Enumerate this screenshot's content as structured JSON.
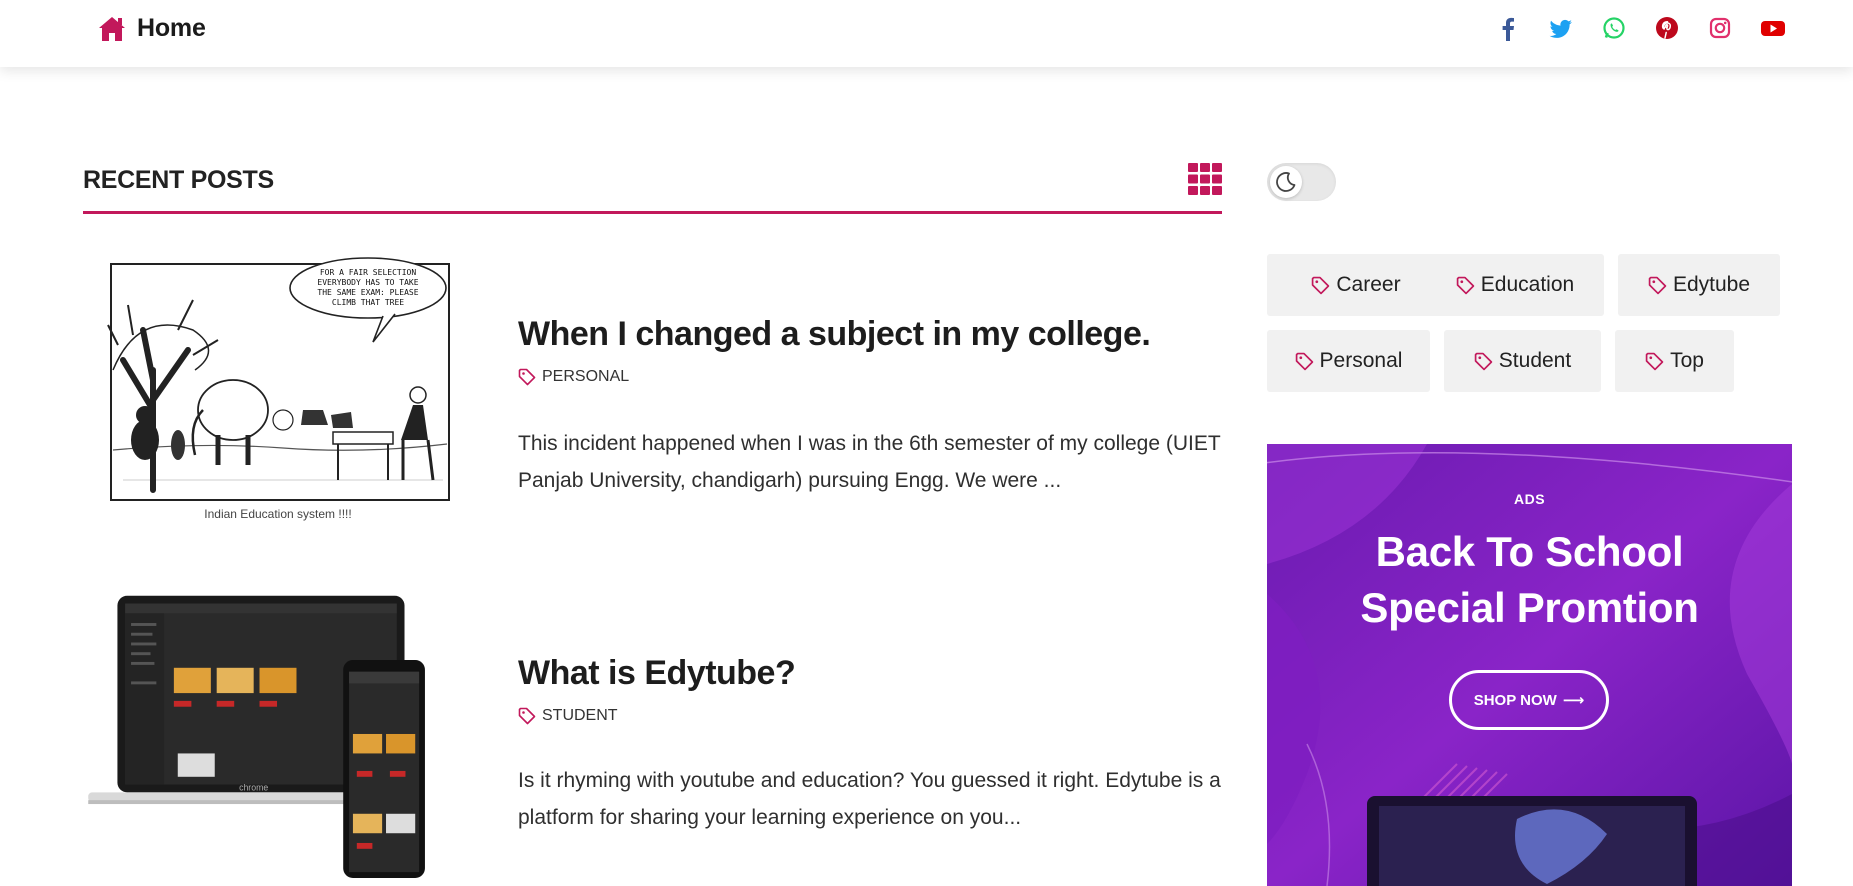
{
  "header": {
    "home_label": "Home",
    "social": [
      {
        "name": "facebook",
        "color": "#3b5998"
      },
      {
        "name": "twitter",
        "color": "#1da1f2"
      },
      {
        "name": "whatsapp",
        "color": "#25d366"
      },
      {
        "name": "pinterest",
        "color": "#bd081c"
      },
      {
        "name": "instagram",
        "color": "#e1306c"
      },
      {
        "name": "youtube",
        "color": "#e00000"
      }
    ]
  },
  "theme": {
    "accent": "#c2185b",
    "text": "#222222",
    "chip_bg": "#f1f1f1"
  },
  "main": {
    "section_title": "RECENT POSTS",
    "posts": [
      {
        "title": "When I changed a subject in my college.",
        "tag": "PERSONAL",
        "excerpt": "This incident happened when I was in the 6th semester of my college (UIET Panjab University, chandigarh) pursuing Engg. We were ...",
        "image_caption": "Indian Education system !!!!",
        "image_text": "FOR A FAIR SELECTION EVERYBODY HAS TO TAKE THE SAME EXAM: PLEASE CLIMB THAT TREE"
      },
      {
        "title": "What is Edytube?",
        "tag": "STUDENT",
        "excerpt": "Is it rhyming with youtube and education? You guessed it right. Edytube is a platform for sharing your learning experience on you...",
        "image_text": "chrome"
      }
    ]
  },
  "sidebar": {
    "dark_mode_toggle": "off",
    "tags": [
      "Career",
      "Education",
      "Edytube",
      "Personal",
      "Student",
      "Top"
    ],
    "ad": {
      "label": "ADS",
      "title_line1": "Back To School",
      "title_line2": "Special Promtion",
      "button": "SHOP NOW"
    }
  }
}
